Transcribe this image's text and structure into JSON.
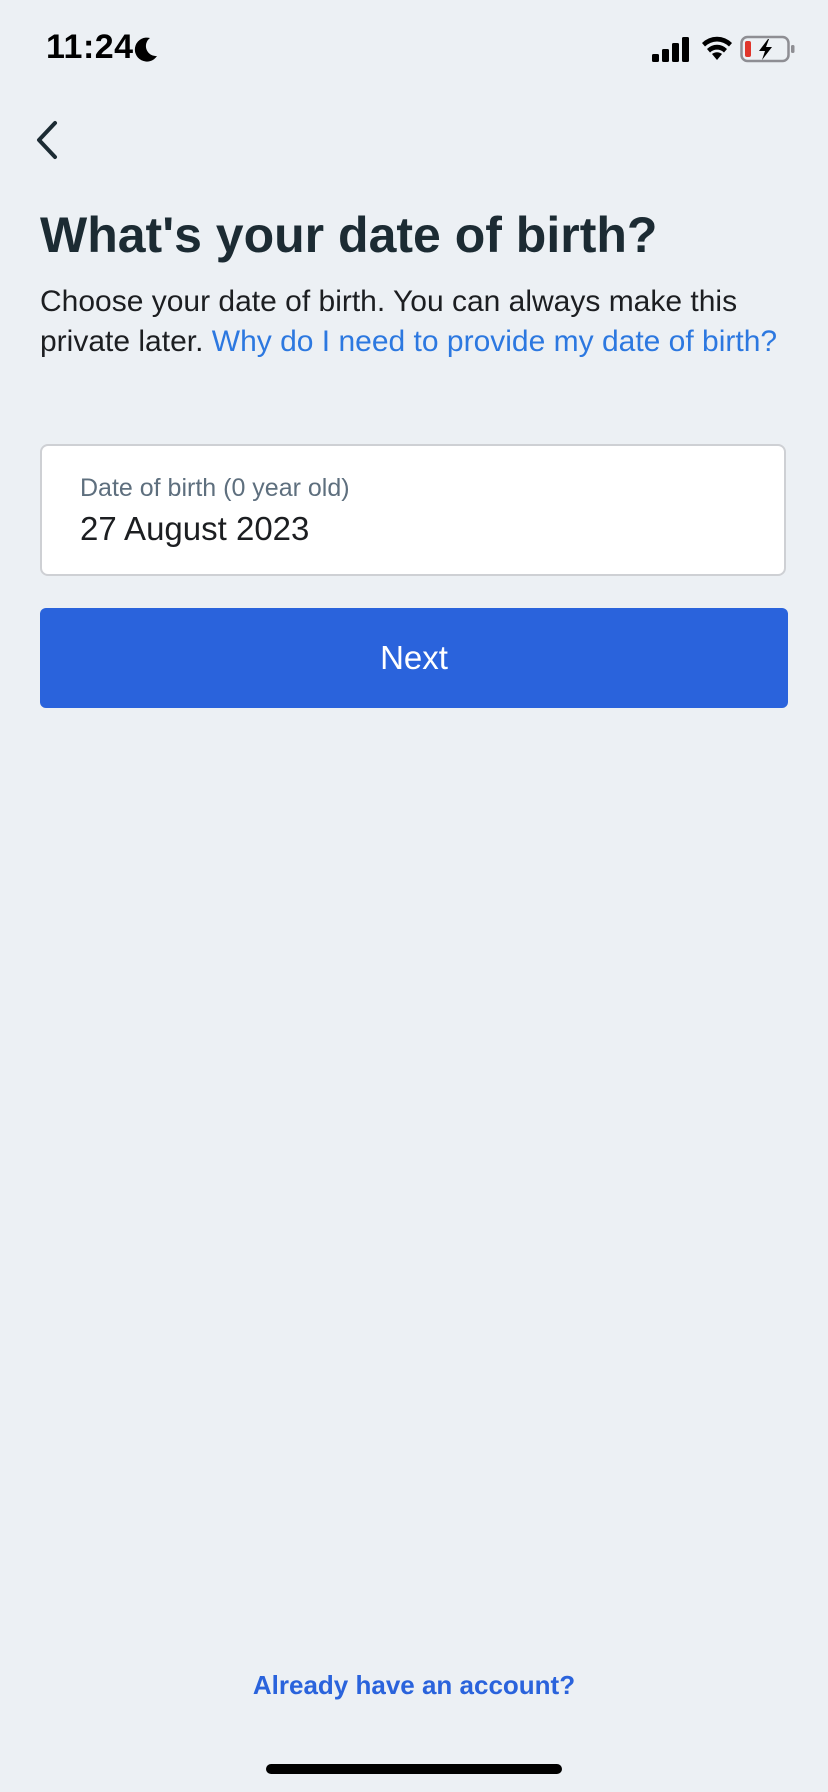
{
  "status_bar": {
    "time": "11:24",
    "icons": [
      "moon-icon",
      "cellular-signal-icon",
      "wifi-icon",
      "battery-charging-icon"
    ],
    "battery_color": "#e0352b"
  },
  "nav": {
    "back_icon": "chevron-left-icon"
  },
  "page": {
    "title": "What's your date of birth?",
    "description": "Choose your date of birth. You can always make this private later. ",
    "help_link": "Why do I need to provide my date of birth?"
  },
  "dob_field": {
    "label": "Date of birth (0 year old)",
    "value": "27 August 2023"
  },
  "actions": {
    "next_label": "Next",
    "login_link": "Already have an account?"
  },
  "colors": {
    "background": "#ecf0f4",
    "primary": "#2a63dc",
    "link": "#2c78e0",
    "title": "#1c2b33"
  }
}
